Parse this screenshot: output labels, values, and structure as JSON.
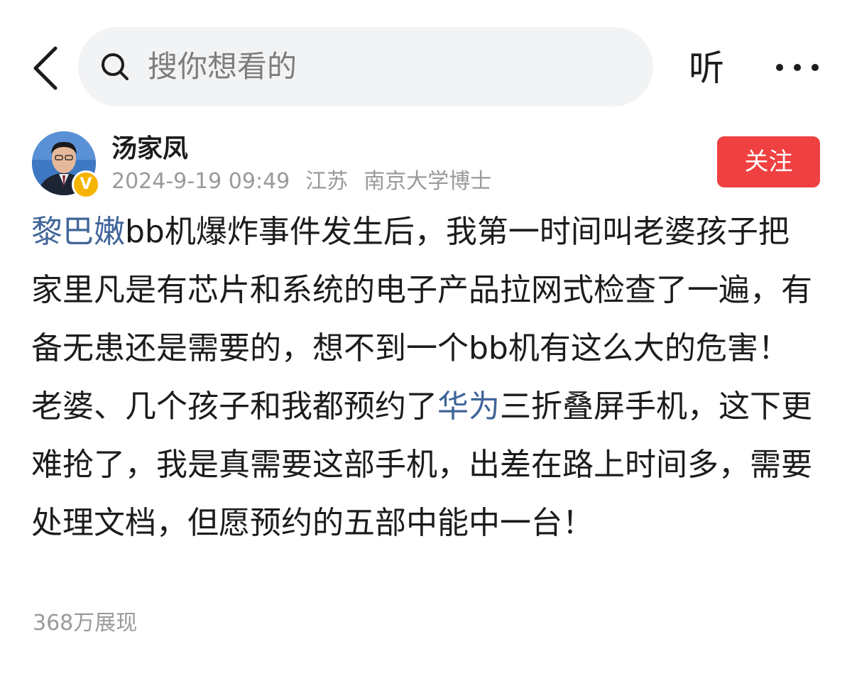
{
  "header": {
    "search_placeholder": "搜你想看的",
    "listen_label": "听"
  },
  "author": {
    "name": "汤家凤",
    "verified_mark": "V",
    "date": "2024-9-19 09:49",
    "location": "江苏",
    "title": "南京大学博士",
    "follow_label": "关注"
  },
  "post": {
    "p1_link": "黎巴嫩",
    "p1_text": "bb机爆炸事件发生后，我第一时间叫老婆孩子把家里凡是有芯片和系统的电子产品拉网式检查了一遍，有备无患还是需要的，想不到一个bb机有这么大的危害！",
    "p2_before": "老婆、几个孩子和我都预约了",
    "p2_link": "华为",
    "p2_after": "三折叠屏手机，这下更难抢了，我是真需要这部手机，出差在路上时间多，需要处理文档，但愿预约的五部中能中一台！"
  },
  "stats": {
    "views": "368万展现"
  },
  "colors": {
    "link": "#406599",
    "follow_bg": "#f04142",
    "meta_text": "#9a9a9a",
    "search_bg": "#f2f3f5",
    "verified": "#f5b400"
  },
  "icons": [
    "chevron-left-icon",
    "search-icon",
    "more-icon",
    "verified-icon"
  ]
}
